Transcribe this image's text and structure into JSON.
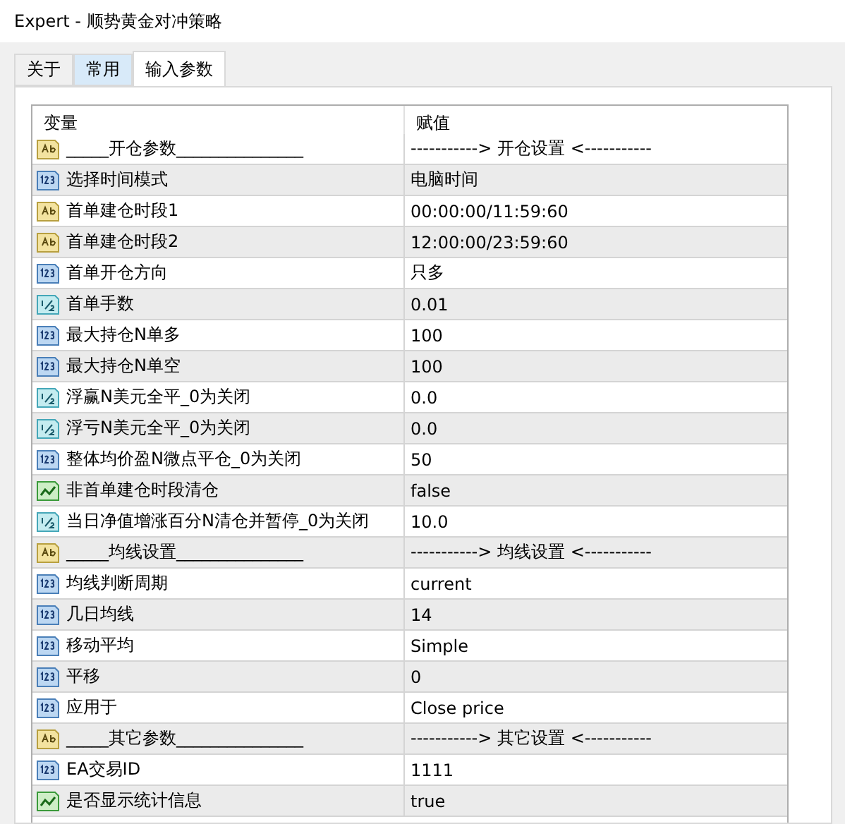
{
  "window": {
    "title": "Expert - 顺势黄金对冲策略"
  },
  "tabs": [
    {
      "label": "关于",
      "selected": false,
      "hovered": false
    },
    {
      "label": "常用",
      "selected": false,
      "hovered": true
    },
    {
      "label": "输入参数",
      "selected": true,
      "hovered": false
    }
  ],
  "table": {
    "columns": [
      "变量",
      "赋值"
    ],
    "rows": [
      {
        "kind": "string",
        "name": "_____开仓参数_______________",
        "value": "-----------> 开仓设置 <-----------"
      },
      {
        "kind": "int",
        "name": "选择时间模式",
        "value": "电脑时间"
      },
      {
        "kind": "string",
        "name": "首单建仓时段1",
        "value": "00:00:00/11:59:60"
      },
      {
        "kind": "string",
        "name": "首单建仓时段2",
        "value": "12:00:00/23:59:60"
      },
      {
        "kind": "int",
        "name": "首单开仓方向",
        "value": "只多"
      },
      {
        "kind": "double",
        "name": "首单手数",
        "value": "0.01"
      },
      {
        "kind": "int",
        "name": "最大持仓N单多",
        "value": "100"
      },
      {
        "kind": "int",
        "name": "最大持仓N单空",
        "value": "100"
      },
      {
        "kind": "double",
        "name": "浮赢N美元全平_0为关闭",
        "value": "0.0"
      },
      {
        "kind": "double",
        "name": "浮亏N美元全平_0为关闭",
        "value": "0.0"
      },
      {
        "kind": "int",
        "name": "整体均价盈N微点平仓_0为关闭",
        "value": "50"
      },
      {
        "kind": "bool",
        "name": "非首单建仓时段清仓",
        "value": "false"
      },
      {
        "kind": "double",
        "name": "当日净值增涨百分N清仓并暂停_0为关闭",
        "value": "10.0"
      },
      {
        "kind": "string",
        "name": "_____均线设置_______________",
        "value": "-----------> 均线设置 <-----------"
      },
      {
        "kind": "int",
        "name": "均线判断周期",
        "value": "current"
      },
      {
        "kind": "int",
        "name": "几日均线",
        "value": "14"
      },
      {
        "kind": "int",
        "name": "移动平均",
        "value": "Simple"
      },
      {
        "kind": "int",
        "name": "平移",
        "value": "0"
      },
      {
        "kind": "int",
        "name": "应用于",
        "value": "Close price"
      },
      {
        "kind": "string",
        "name": "_____其它参数_______________",
        "value": "-----------> 其它设置 <-----------"
      },
      {
        "kind": "int",
        "name": "EA交易ID",
        "value": "1111"
      },
      {
        "kind": "bool",
        "name": "是否显示统计信息",
        "value": "true"
      }
    ]
  }
}
